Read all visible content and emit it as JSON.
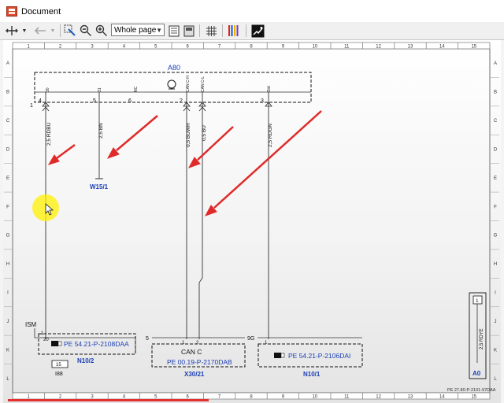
{
  "window": {
    "title": "Document"
  },
  "toolbar": {
    "zoom_value": "Whole page"
  },
  "grid": {
    "columns": [
      "1",
      "2",
      "3",
      "4",
      "5",
      "6",
      "7",
      "8",
      "9",
      "10",
      "11",
      "12",
      "13",
      "14",
      "15"
    ],
    "rows": [
      "A",
      "B",
      "C",
      "D",
      "E",
      "F",
      "G",
      "H",
      "I",
      "J",
      "K",
      "L"
    ]
  },
  "diagram": {
    "component_a80": {
      "name": "A80",
      "pins": [
        "4",
        "5",
        "6",
        "2",
        "1",
        "3"
      ],
      "pin_labels": [
        "30",
        "31",
        "NC",
        "CAN C-H",
        "CAN C-L",
        "Std"
      ]
    },
    "wires": [
      {
        "label": "2,5 RDBU"
      },
      {
        "label": "2,5 BN"
      },
      {
        "label": "0,5 BUWH"
      },
      {
        "label": "0,5 BU"
      },
      {
        "label": "2,5 RDGN"
      }
    ],
    "ground_w15": "W15/1",
    "ism": {
      "label": "ISM",
      "pin_top": "20",
      "pin_left": "1",
      "ref": "PE 54.21-P-2108DAA",
      "name": "N10/2",
      "fuse_block": "I88",
      "fuse": "15"
    },
    "can_c": {
      "number": "5",
      "label": "CAN C",
      "pin1": "1",
      "pin2": "2",
      "ref": "PE 00.19-P-2170DAB",
      "name": "X30/21"
    },
    "n10_1": {
      "number": "9G",
      "pin": "1",
      "ref": "PE 54.21-P-2106DAI",
      "name": "N10/1"
    },
    "a0": {
      "pin": "1",
      "wire": "2,5 RDYE",
      "name": "A0"
    },
    "page_ref": "PE 27.80-P-2101-97DAA"
  }
}
